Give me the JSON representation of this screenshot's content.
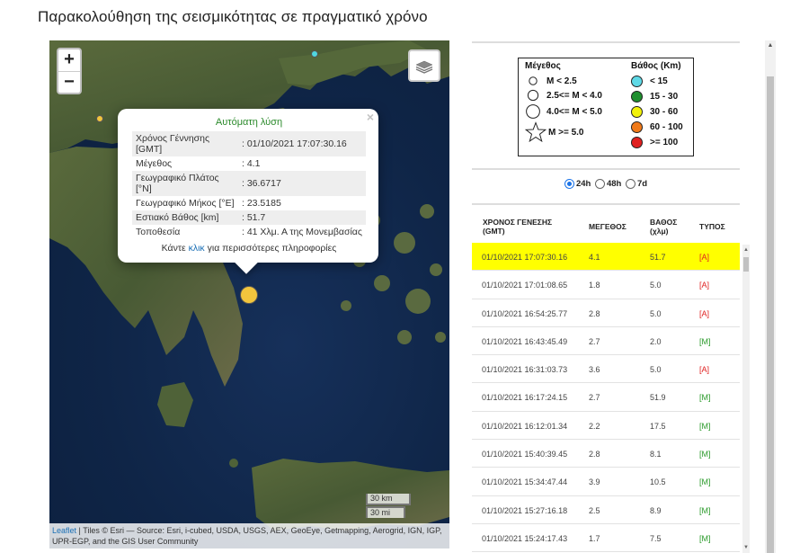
{
  "page": {
    "title": "Παρακολούθηση της σεισμικότητας σε πραγματικό χρόνο"
  },
  "map": {
    "zoom_in": "+",
    "zoom_out": "−",
    "layers_icon": "layers-icon",
    "popup": {
      "close": "×",
      "title": "Αυτόματη λύση",
      "fields": [
        {
          "key": "Χρόνος Γέννησης [GMT]",
          "value": ": 01/10/2021 17:07:30.16"
        },
        {
          "key": "Μέγεθος",
          "value": ": 4.1"
        },
        {
          "key": "Γεωγραφικό Πλάτος [°N]",
          "value": ": 36.6717"
        },
        {
          "key": "Γεωγραφικό Μήκος [°E]",
          "value": ": 23.5185"
        },
        {
          "key": "Εστιακό Βάθος [km]",
          "value": ": 51.7"
        },
        {
          "key": "Τοποθεσία",
          "value": ": 41 Χλμ. Α της Μονεμβασίας"
        }
      ],
      "more_prefix": "Κάντε ",
      "more_link": "κλικ",
      "more_suffix": " για περισσότερες πληροφορίες"
    },
    "scale_km": "30 km",
    "scale_mi": "30 mi",
    "attribution_link": "Leaflet",
    "attribution_text": " | Tiles © Esri — Source: Esri, i-cubed, USDA, USGS, AEX, GeoEye, Getmapping, Aerogrid, IGN, IGP, UPR-EGP, and the GIS User Community",
    "colors": {
      "water": "#0f2547",
      "land": "#4a5e33",
      "marker_yellow": "#f2c53d",
      "marker_cyan": "#4fd6e0"
    }
  },
  "legend": {
    "magnitude_title": "Μέγεθος",
    "magnitude_items": [
      "M < 2.5",
      "2.5<= M < 4.0",
      "4.0<= M < 5.0",
      "M >= 5.0"
    ],
    "depth_title": "Βάθος (Km)",
    "depth_items": [
      {
        "label": "< 15",
        "color": "#5fd9e6"
      },
      {
        "label": "15 - 30",
        "color": "#1f8f2f"
      },
      {
        "label": "30 - 60",
        "color": "#f2f20a"
      },
      {
        "label": "60 - 100",
        "color": "#f07a1a"
      },
      {
        "label": ">= 100",
        "color": "#e02020"
      }
    ]
  },
  "period": {
    "options": [
      "24h",
      "48h",
      "7d"
    ],
    "selected": "24h"
  },
  "table": {
    "headers": {
      "time": "ΧΡΟΝΟΣ ΓΕΝΕΣΗΣ (GMT)",
      "time_l1": "ΧΡΟΝΟΣ ΓΕΝΕΣΗΣ",
      "time_l2": "(GMT)",
      "mag": "ΜΕΓΕΘΟΣ",
      "depth_l1": "ΒΑΘΟΣ",
      "depth_l2": "(χλμ)",
      "type": "ΤΥΠΟΣ"
    },
    "rows": [
      {
        "time": "01/10/2021 17:07:30.16",
        "mag": "4.1",
        "depth": "51.7",
        "type": "[A]"
      },
      {
        "time": "01/10/2021 17:01:08.65",
        "mag": "1.8",
        "depth": "5.0",
        "type": "[A]"
      },
      {
        "time": "01/10/2021 16:54:25.77",
        "mag": "2.8",
        "depth": "5.0",
        "type": "[A]"
      },
      {
        "time": "01/10/2021 16:43:45.49",
        "mag": "2.7",
        "depth": "2.0",
        "type": "[M]"
      },
      {
        "time": "01/10/2021 16:31:03.73",
        "mag": "3.6",
        "depth": "5.0",
        "type": "[A]"
      },
      {
        "time": "01/10/2021 16:17:24.15",
        "mag": "2.7",
        "depth": "51.9",
        "type": "[M]"
      },
      {
        "time": "01/10/2021 16:12:01.34",
        "mag": "2.2",
        "depth": "17.5",
        "type": "[M]"
      },
      {
        "time": "01/10/2021 15:40:39.45",
        "mag": "2.8",
        "depth": "8.1",
        "type": "[M]"
      },
      {
        "time": "01/10/2021 15:34:47.44",
        "mag": "3.9",
        "depth": "10.5",
        "type": "[M]"
      },
      {
        "time": "01/10/2021 15:27:16.18",
        "mag": "2.5",
        "depth": "8.9",
        "type": "[M]"
      },
      {
        "time": "01/10/2021 15:24:17.43",
        "mag": "1.7",
        "depth": "7.5",
        "type": "[M]"
      }
    ],
    "selected_index": 0,
    "highlight_color": "#ffff00"
  }
}
